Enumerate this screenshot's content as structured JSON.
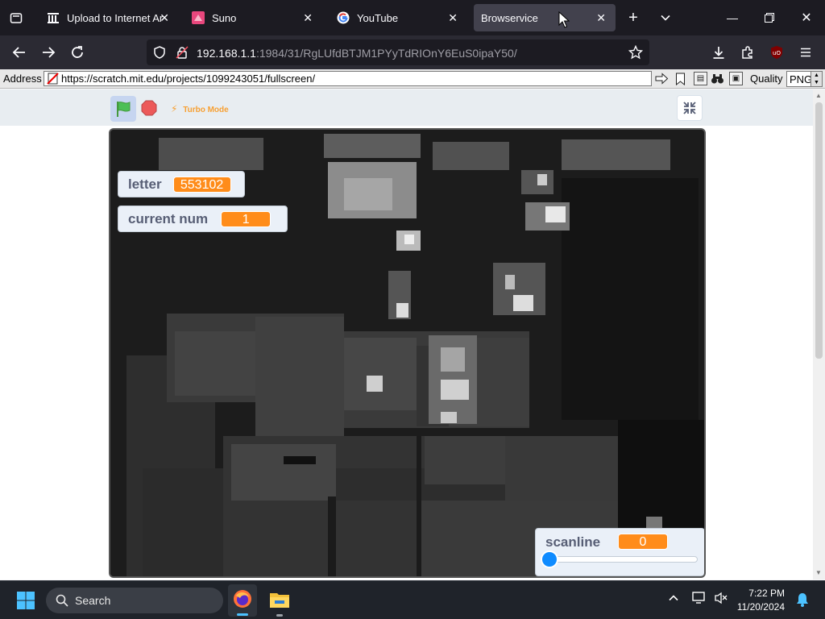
{
  "tabs": [
    {
      "title": "Upload to Internet Archive",
      "icon": "archive-icon",
      "active": false
    },
    {
      "title": "Suno",
      "icon": "suno-icon",
      "active": false
    },
    {
      "title": "YouTube",
      "icon": "google-icon",
      "active": false
    },
    {
      "title": "Browservice",
      "icon": "none",
      "active": true
    }
  ],
  "nav": {
    "url_host": "192.168.1.1",
    "url_rest": ":1984/31/RgLUfdBTJM1PYyTdRIOnY6EuS0ipaY50/"
  },
  "browservice": {
    "address_label": "Address",
    "address_url": "https://scratch.mit.edu/projects/1099243051/fullscreen/",
    "quality_label": "Quality",
    "quality_value": "PNG"
  },
  "scratch": {
    "turbo_label": "Turbo Mode",
    "monitors": {
      "letter": {
        "label": "letter",
        "value": "553102"
      },
      "current_num": {
        "label": "current num",
        "value": "1"
      },
      "scanline": {
        "label": "scanline",
        "value": "0",
        "slider_fraction": 0
      }
    }
  },
  "taskbar": {
    "search_placeholder": "Search",
    "time": "7:22 PM",
    "date": "11/20/2024"
  },
  "colors": {
    "scratch_orange": "#ff8c1a",
    "flag_green": "#4cbf56",
    "stop_red": "#ec5959",
    "slider_blue": "#0f8bff"
  }
}
